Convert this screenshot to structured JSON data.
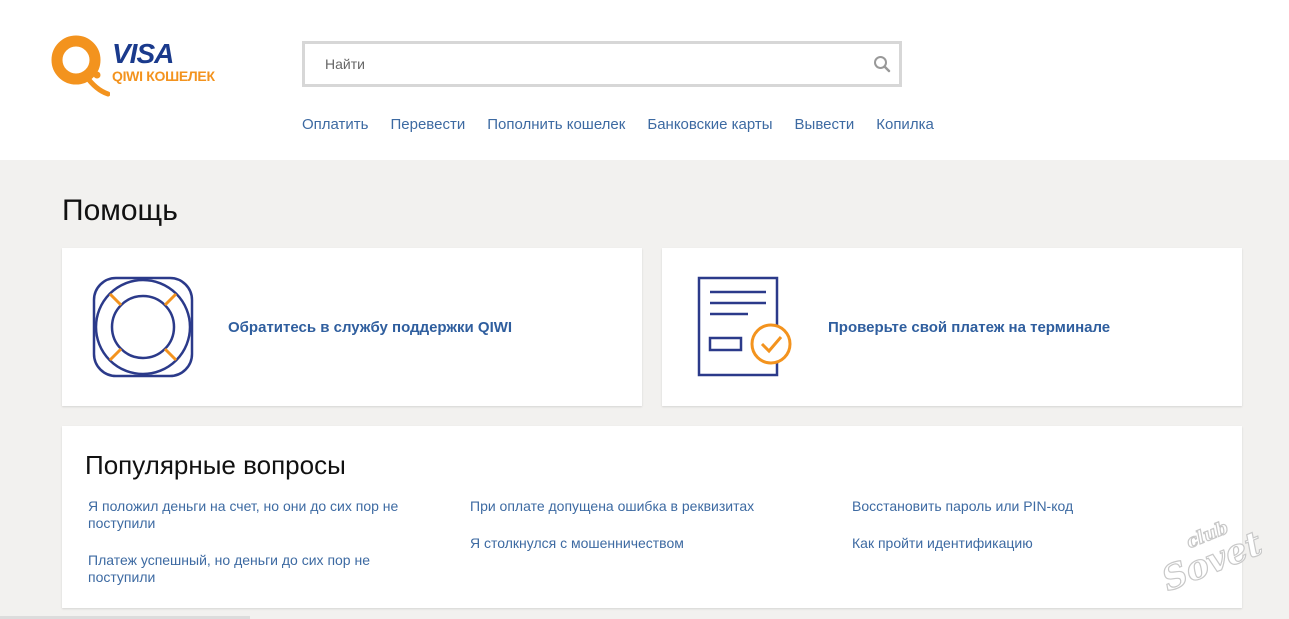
{
  "header": {
    "logo": {
      "brand": "VISA",
      "subtitle": "QIWI КОШЕЛЕК",
      "brand_color": "#1a3a8c",
      "accent_color": "#f3931e"
    },
    "search": {
      "placeholder": "Найти",
      "icon": "search-icon"
    },
    "nav": [
      {
        "label": "Оплатить"
      },
      {
        "label": "Перевести"
      },
      {
        "label": "Пополнить кошелек"
      },
      {
        "label": "Банковские карты"
      },
      {
        "label": "Вывести"
      },
      {
        "label": "Копилка"
      }
    ]
  },
  "main": {
    "title": "Помощь",
    "cards": [
      {
        "label": "Обратитесь в службу поддержки QIWI",
        "icon": "lifebuoy-icon"
      },
      {
        "label": "Проверьте свой платеж на терминале",
        "icon": "receipt-check-icon"
      }
    ],
    "faq": {
      "title": "Популярные вопросы",
      "columns": [
        [
          "Я положил деньги на счет, но они до сих пор не поступили",
          "Платеж успешный, но деньги до сих пор не поступили"
        ],
        [
          "При оплате допущена ошибка в реквизитах",
          "Я столкнулся с мошенничеством"
        ],
        [
          "Восстановить пароль или PIN-код",
          "Как пройти идентификацию"
        ]
      ]
    }
  },
  "watermark": {
    "text_top": "club",
    "text_bottom": "Sovet"
  },
  "colors": {
    "link": "#3d6aa2",
    "icon_navy": "#2b3a8a",
    "icon_orange": "#f3931e",
    "background": "#f2f1ef"
  }
}
